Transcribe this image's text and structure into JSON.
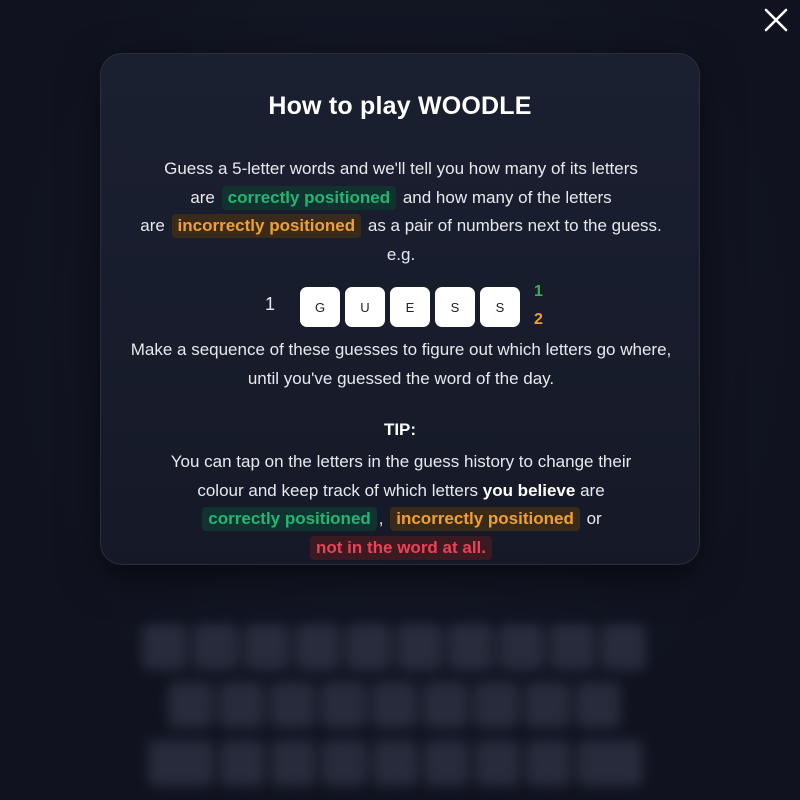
{
  "close_icon": "close-icon",
  "modal": {
    "title": "How to play WOODLE",
    "intro": {
      "line1": "Guess a 5-letter words and we'll tell you how many of its letters",
      "are1": "are",
      "correct": "correctly positioned",
      "mid": "and how many of the letters",
      "are2": "are",
      "incorrect": "incorrectly positioned",
      "tail": "as a pair of numbers next to the guess.",
      "eg": "e.g."
    },
    "example": {
      "row_number": "1",
      "letters": [
        "G",
        "U",
        "E",
        "S",
        "S"
      ],
      "correct_count": "1",
      "incorrect_count": "2"
    },
    "sequence_text": "Make a sequence of these guesses to figure out which letters go where, until you've guessed the word of the day.",
    "tip": {
      "title": "TIP:",
      "line1": "You can tap on the letters in the guess history to change their",
      "line2_start": "colour and keep track of which letters",
      "you_believe": "you believe",
      "are": "are",
      "correct": "correctly positioned",
      "comma": ",",
      "incorrect": "incorrectly positioned",
      "or": "or",
      "not_in_word": "not in the word at all."
    }
  },
  "colors": {
    "correct": "#20b774",
    "incorrect": "#f0a030",
    "absent": "#ef4155",
    "background": "#10131f"
  }
}
